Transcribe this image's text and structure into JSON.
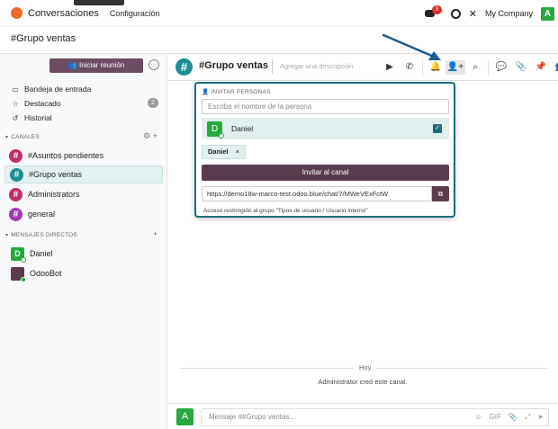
{
  "navbar": {
    "app_name": "Conversaciones",
    "menu_config": "Configuración",
    "notification_count": "3",
    "company": "My Company",
    "user_initial": "A"
  },
  "page": {
    "title": "#Grupo ventas"
  },
  "sidebar": {
    "start_meeting": "Iniciar reunión",
    "more": "···",
    "items": [
      {
        "label": "Bandeja de entrada",
        "icon": "inbox-icon"
      },
      {
        "label": "Destacado",
        "icon": "star-icon",
        "count": "2"
      },
      {
        "label": "Historial",
        "icon": "history-icon"
      }
    ],
    "channels_header": "CANALES",
    "channels": [
      {
        "label": "#Asuntos pendientes",
        "color": "#c0306a"
      },
      {
        "label": "#Grupo ventas",
        "color": "#1d8e94",
        "active": true
      },
      {
        "label": "Administrators",
        "color": "#c0306a"
      },
      {
        "label": "general",
        "color": "#a33bb3"
      }
    ],
    "dm_header": "MENSAJES DIRECTOS",
    "direct_messages": [
      {
        "label": "Daniel",
        "initial": "D",
        "color": "#27a93f",
        "status": "#ffffff"
      },
      {
        "label": "OdooBot",
        "initial": "",
        "color": "#5b3c4f",
        "status": "#27a93f"
      }
    ]
  },
  "header": {
    "hash": "#",
    "title": "#Grupo ventas",
    "description_placeholder": "Agregar una descripción"
  },
  "invite": {
    "header": "INVITAR PERSONAS",
    "search_placeholder": "Escriba el nombre de la persona",
    "result_name": "Daniel",
    "result_initial": "D",
    "chip_label": "Daniel",
    "chip_remove": "×",
    "invite_button": "Invitar al canal",
    "link": "https://demo18w-marco-test.odoo.blue/chat/7/MWeVExFctW",
    "restriction": "Acceso restringido al grupo \"Tipos de usuario / Usuario interno\""
  },
  "messages": {
    "day": "Hoy",
    "notice": "Administrator creó este canal."
  },
  "composer": {
    "user_initial": "A",
    "placeholder": "Mensaje ##Grupo ventas...",
    "gif": "GIF"
  },
  "colors": {
    "accent": "#1e6d79",
    "primary": "#5b3c4f"
  }
}
